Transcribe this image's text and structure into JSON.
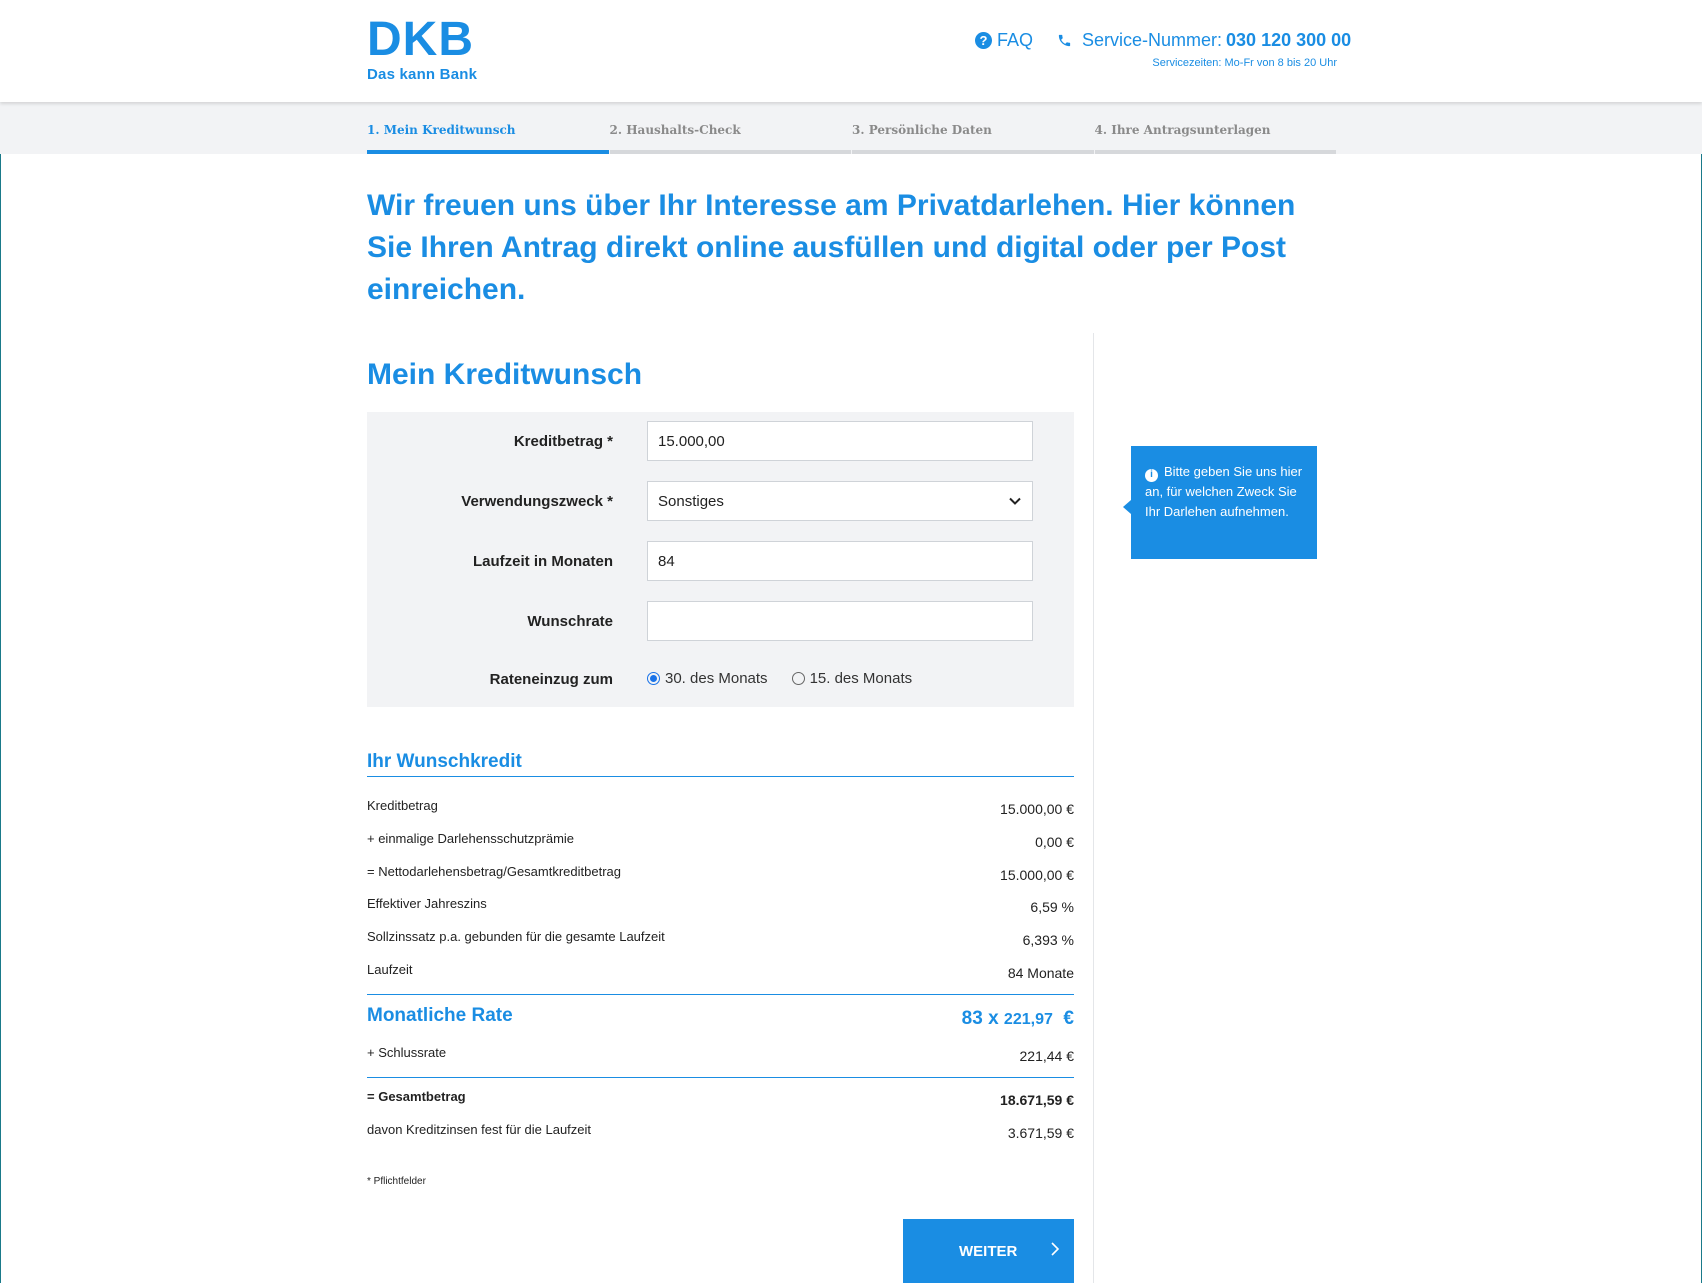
{
  "header": {
    "logo_mark": "DKB",
    "logo_sub": "Das kann Bank",
    "faq_label": "FAQ",
    "service_label": "Service-Nummer:",
    "service_number": "030 120 300 00",
    "service_times": "Servicezeiten: Mo-Fr von 8 bis 20 Uhr"
  },
  "steps": [
    {
      "label": "1. Mein Kreditwunsch",
      "active": true
    },
    {
      "label": "2. Haushalts-Check",
      "active": false
    },
    {
      "label": "3. Persönliche Daten",
      "active": false
    },
    {
      "label": "4. Ihre Antragsunterlagen",
      "active": false
    }
  ],
  "intro": "Wir freuen uns über Ihr Interesse am Privatdarlehen. Hier können Sie Ihren Antrag direkt online ausfüllen und digital oder per Post einreichen.",
  "form": {
    "title": "Mein Kreditwunsch",
    "kreditbetrag_label": "Kreditbetrag *",
    "kreditbetrag_value": "15.000,00",
    "verwendung_label": "Verwendungszweck *",
    "verwendung_value": "Sonstiges",
    "laufzeit_label": "Laufzeit in Monaten",
    "laufzeit_value": "84",
    "wunschrate_label": "Wunschrate",
    "wunschrate_value": "",
    "rateneinzug_label": "Rateneinzug zum",
    "radio_1": "30. des Monats",
    "radio_2": "15. des Monats"
  },
  "tooltip": "Bitte geben Sie uns hier an, für welchen Zweck Sie Ihr Darlehen aufnehmen.",
  "summary": {
    "title": "Ihr Wunschkredit",
    "rows": [
      {
        "label": "Kreditbetrag",
        "value": "15.000,00  €"
      },
      {
        "label": "+ einmalige Darlehensschutzprämie",
        "value": "0,00  €"
      },
      {
        "label": "= Nettodarlehensbetrag/Gesamtkreditbetrag",
        "value": "15.000,00  €"
      },
      {
        "label": "Effektiver Jahreszins",
        "value": "6,59  %"
      },
      {
        "label": "Sollzinssatz p.a. gebunden für die gesamte Laufzeit",
        "value": "6,393  %"
      },
      {
        "label": "Laufzeit",
        "value": "84  Monate"
      }
    ],
    "rate_label": "Monatliche Rate",
    "rate_count": "83 x",
    "rate_amount": "221,97",
    "rate_currency": "€",
    "schlussrate_label": "+ Schlussrate",
    "schlussrate_value": "221,44  €",
    "gesamt_label": "= Gesamtbetrag",
    "gesamt_value": "18.671,59  €",
    "zinsen_label": "davon Kreditzinsen fest für die Laufzeit",
    "zinsen_value": "3.671,59  €"
  },
  "note": "*  Pflichtfelder",
  "weiter_label": "WEITER",
  "colors": {
    "brand": "#1a8de3",
    "panel": "#f2f3f5"
  }
}
